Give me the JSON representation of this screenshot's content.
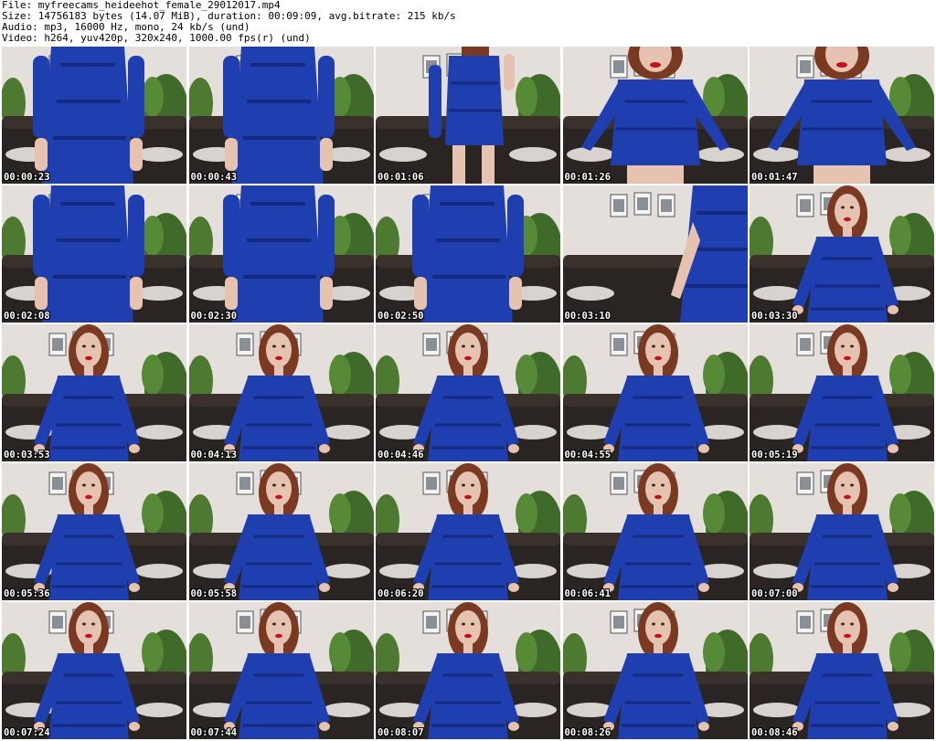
{
  "header": {
    "file": "File: myfreecams_heideehot_female_29012017.mp4",
    "size": "Size: 14756183 bytes (14.07 MiB), duration: 00:09:09, avg.bitrate: 215 kb/s",
    "audio": "Audio: mp3, 16000 Hz, mono, 24 kb/s (und)",
    "video": "Video: h264, yuv420p, 320x240, 1000.00 fps(r) (und)"
  },
  "colors": {
    "wall": "#e4dfda",
    "sofa": "#2a2422",
    "dress": "#1f3fb0",
    "dress_dark": "#142a80",
    "skin": "#e6c2b0",
    "hair": "#7a3a22",
    "plant": "#3f6a2a",
    "lips": "#c0141c"
  },
  "thumbnails": [
    {
      "time": "00:00:23",
      "pose": "body"
    },
    {
      "time": "00:00:43",
      "pose": "body"
    },
    {
      "time": "00:01:06",
      "pose": "standing"
    },
    {
      "time": "00:01:26",
      "pose": "lean"
    },
    {
      "time": "00:01:47",
      "pose": "lean"
    },
    {
      "time": "00:02:08",
      "pose": "body"
    },
    {
      "time": "00:02:30",
      "pose": "body"
    },
    {
      "time": "00:02:50",
      "pose": "body"
    },
    {
      "time": "00:03:10",
      "pose": "side"
    },
    {
      "time": "00:03:30",
      "pose": "seated"
    },
    {
      "time": "00:03:53",
      "pose": "seated"
    },
    {
      "time": "00:04:13",
      "pose": "seated"
    },
    {
      "time": "00:04:46",
      "pose": "seated"
    },
    {
      "time": "00:04:55",
      "pose": "seated"
    },
    {
      "time": "00:05:19",
      "pose": "seated"
    },
    {
      "time": "00:05:36",
      "pose": "seated"
    },
    {
      "time": "00:05:58",
      "pose": "seated"
    },
    {
      "time": "00:06:20",
      "pose": "seated"
    },
    {
      "time": "00:06:41",
      "pose": "seated"
    },
    {
      "time": "00:07:00",
      "pose": "seated"
    },
    {
      "time": "00:07:24",
      "pose": "seated"
    },
    {
      "time": "00:07:44",
      "pose": "seated"
    },
    {
      "time": "00:08:07",
      "pose": "seated"
    },
    {
      "time": "00:08:26",
      "pose": "seated"
    },
    {
      "time": "00:08:46",
      "pose": "seated"
    }
  ]
}
